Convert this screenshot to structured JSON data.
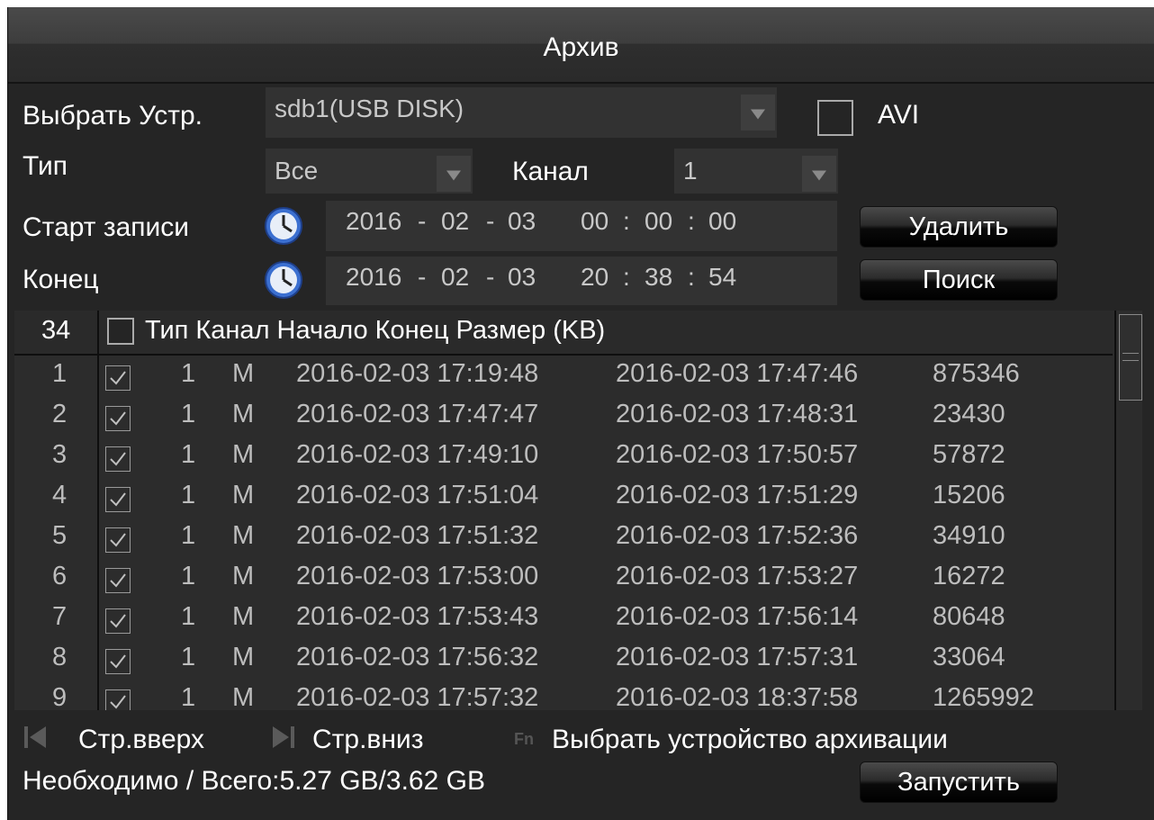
{
  "window": {
    "title": "Архив"
  },
  "device": {
    "label": "Выбрать Устр.",
    "value": "sdb1(USB DISK)",
    "avi_label": "AVI",
    "avi_checked": false
  },
  "type": {
    "label": "Тип",
    "value": "Все"
  },
  "channel": {
    "label": "Канал",
    "value": "1"
  },
  "start": {
    "label": "Старт записи",
    "year": "2016",
    "month": "02",
    "day": "03",
    "hh": "00",
    "mm": "00",
    "ss": "00"
  },
  "end": {
    "label": "Конец",
    "year": "2016",
    "month": "02",
    "day": "03",
    "hh": "20",
    "mm": "38",
    "ss": "54"
  },
  "buttons": {
    "delete": "Удалить",
    "search": "Поиск",
    "start": "Запустить"
  },
  "table": {
    "count": "34",
    "header": "Тип Канал Начало Конец Размер (KB)",
    "rows": [
      {
        "n": "1",
        "ch": "1",
        "type": "M",
        "start": "2016-02-03 17:19:48",
        "end": "2016-02-03 17:47:46",
        "size": "875346"
      },
      {
        "n": "2",
        "ch": "1",
        "type": "M",
        "start": "2016-02-03 17:47:47",
        "end": "2016-02-03 17:48:31",
        "size": "23430"
      },
      {
        "n": "3",
        "ch": "1",
        "type": "M",
        "start": "2016-02-03 17:49:10",
        "end": "2016-02-03 17:50:57",
        "size": "57872"
      },
      {
        "n": "4",
        "ch": "1",
        "type": "M",
        "start": "2016-02-03 17:51:04",
        "end": "2016-02-03 17:51:29",
        "size": "15206"
      },
      {
        "n": "5",
        "ch": "1",
        "type": "M",
        "start": "2016-02-03 17:51:32",
        "end": "2016-02-03 17:52:36",
        "size": "34910"
      },
      {
        "n": "6",
        "ch": "1",
        "type": "M",
        "start": "2016-02-03 17:53:00",
        "end": "2016-02-03 17:53:27",
        "size": "16272"
      },
      {
        "n": "7",
        "ch": "1",
        "type": "M",
        "start": "2016-02-03 17:53:43",
        "end": "2016-02-03 17:56:14",
        "size": "80648"
      },
      {
        "n": "8",
        "ch": "1",
        "type": "M",
        "start": "2016-02-03 17:56:32",
        "end": "2016-02-03 17:57:31",
        "size": "33064"
      },
      {
        "n": "9",
        "ch": "1",
        "type": "M",
        "start": "2016-02-03 17:57:32",
        "end": "2016-02-03 18:37:58",
        "size": "1265992"
      }
    ]
  },
  "footer": {
    "page_up": "Стр.вверх",
    "page_down": "Стр.вниз",
    "fn_icon": "Fn",
    "select_backup": "Выбрать устройство архивации",
    "required_total": "Необходимо / Всего:5.27 GB/3.62 GB"
  },
  "icons": {
    "clock": "clock-icon",
    "page_up": "page-up-icon",
    "page_down": "page-down-icon",
    "dropdown": "chevron-down-icon"
  }
}
